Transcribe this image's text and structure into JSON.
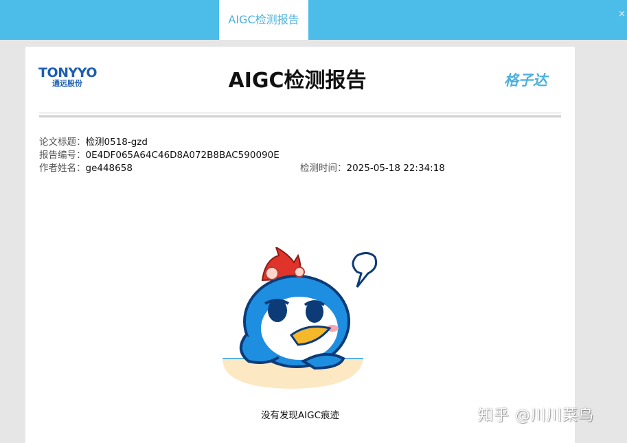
{
  "tab": {
    "label": "AIGC检测报告"
  },
  "topbar": {
    "close_glyph": "×"
  },
  "header": {
    "logo_left_main": "TONYYO",
    "logo_left_sub": "通远股份",
    "title": "AIGC检测报告",
    "logo_right": "格子达"
  },
  "meta": {
    "paper_title_label": "论文标题：",
    "paper_title_value": "检测0518-gzd",
    "report_no_label": "报告编号：",
    "report_no_value": "0E4DF065A64C46D8A072B8BAC590090E",
    "author_label": "作者姓名：",
    "author_value": "ge448658",
    "time_label": "检测时间：",
    "time_value": "2025-05-18 22:34:18"
  },
  "result": {
    "text": "没有发现AIGC痕迹"
  },
  "watermark": {
    "text": "知乎 @川川菜鸟"
  },
  "colors": {
    "topbar": "#4bbde8",
    "accent": "#4bb0de",
    "logo_blue": "#1d5fb1"
  }
}
